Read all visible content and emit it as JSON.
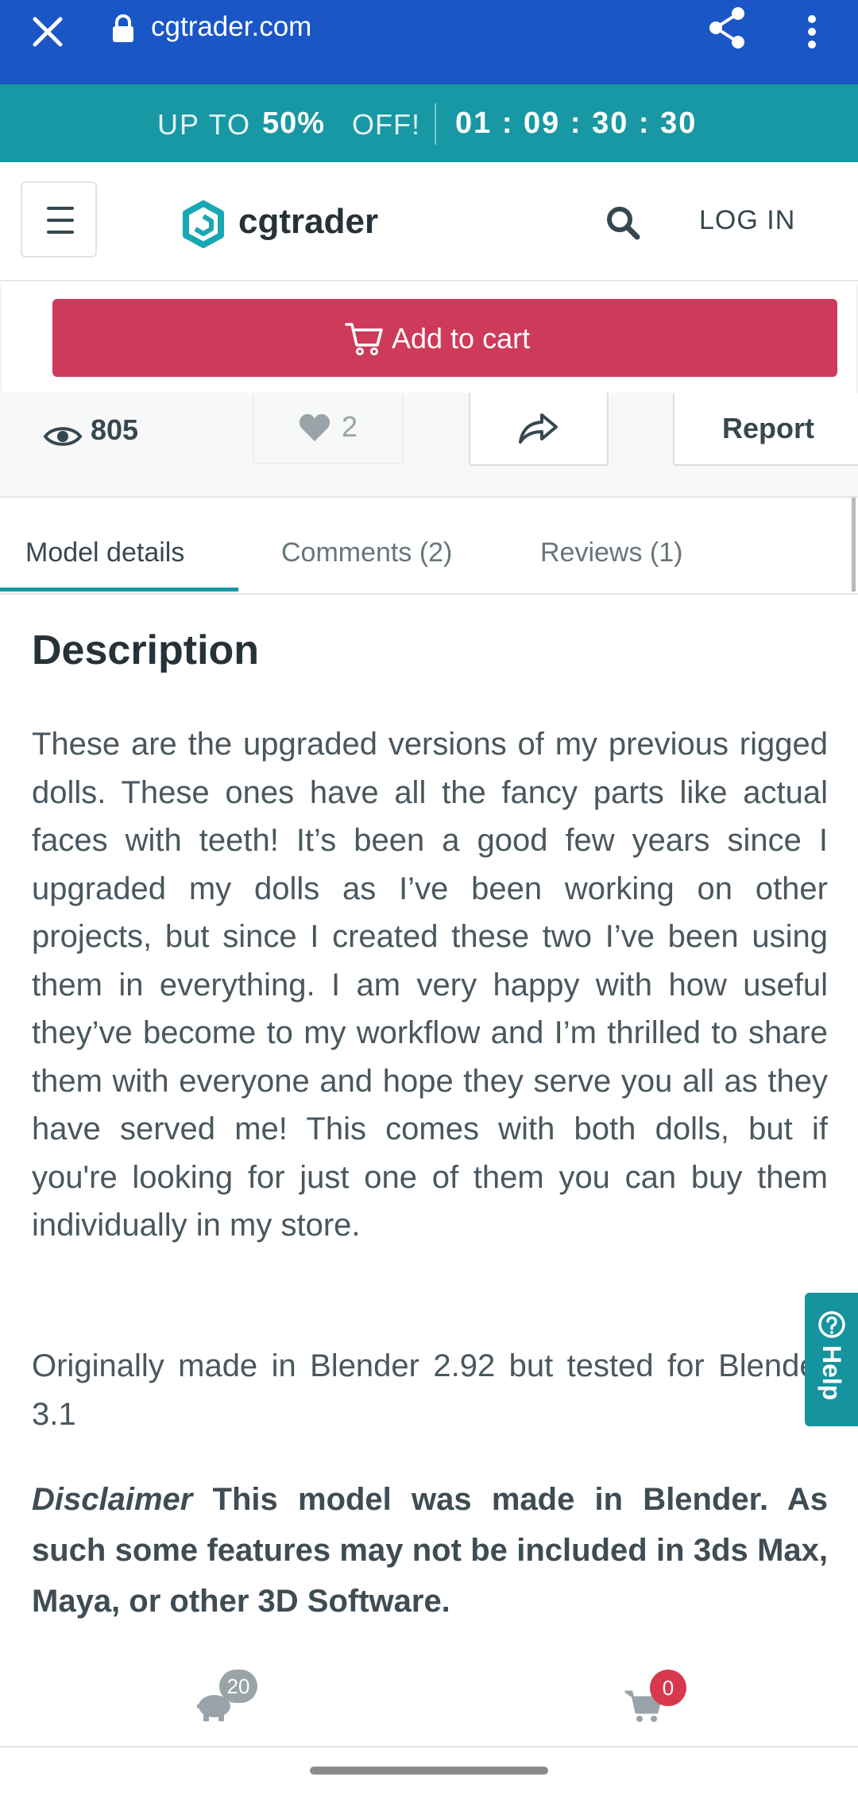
{
  "browser": {
    "url": "cgtrader.com",
    "close_icon": "close-icon",
    "lock_icon": "lock-icon",
    "share_icon": "share-icon",
    "menu_icon": "more-vertical-icon"
  },
  "promo": {
    "prefix": "UP TO",
    "percent": "50%",
    "suffix": "OFF!",
    "timer": "01 : 09 : 30 : 30"
  },
  "header": {
    "logo_text": "cgtrader",
    "login_label": "LOG IN",
    "menu_icon": "hamburger-icon",
    "search_icon": "search-icon"
  },
  "cart": {
    "add_to_cart_label": "Add to cart",
    "icon": "cart-icon"
  },
  "stats": {
    "views": "805",
    "likes": "2",
    "report_label": "Report"
  },
  "tabs": [
    {
      "label": "Model details",
      "active": true
    },
    {
      "label": "Comments (2)",
      "active": false
    },
    {
      "label": "Reviews (1)",
      "active": false
    }
  ],
  "description": {
    "heading": "Description",
    "body": "These are the upgraded versions of my previous rigged dolls. These ones have all the fancy parts like actual faces with teeth! It’s been a good few years since I upgraded my dolls as I’ve been working on other projects, but since I created these two I’ve been using them in everything. I am very happy with how useful they’ve become to my workflow and I’m thrilled to share them with everyone and hope they serve you all as they have served me! This comes with both dolls, but if you're looking for just one of them you can buy them individually in my store.",
    "note": "Originally made in Blender 2.92 but tested for Blender 3.1",
    "disclaimer_label": "Disclaimer",
    "disclaimer_text": " This model was made in Blender. As such some features may not be included in 3ds Max, Maya, or other 3D Software."
  },
  "help": {
    "label": "Help"
  },
  "bottom_bar": {
    "piggy_badge": "20",
    "cart_badge": "0"
  },
  "colors": {
    "browser_bar": "#1a56c6",
    "promo_bar": "#1898a4",
    "add_to_cart": "#cd3a5a",
    "accent": "#1898a4",
    "cart_badge": "#d7384e"
  }
}
